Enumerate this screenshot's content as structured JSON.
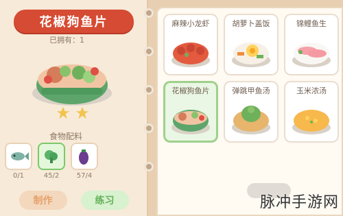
{
  "selected_dish": {
    "title": "花椒狗鱼片",
    "owned_label": "已拥有：1",
    "stars": 2
  },
  "ingredients_label": "食物配料",
  "ingredients": [
    {
      "name": "fish-ingredient",
      "count": "0/1"
    },
    {
      "name": "vegetable-ingredient",
      "count": "45/2"
    },
    {
      "name": "eggplant-ingredient",
      "count": "57/4"
    }
  ],
  "buttons": {
    "make": "制作",
    "practice": "练习"
  },
  "recipes": [
    {
      "title": "麻辣小龙虾"
    },
    {
      "title": "胡萝卜盖饭"
    },
    {
      "title": "锦鲤鱼生"
    },
    {
      "title": "花椒狗鱼片"
    },
    {
      "title": "弹跳甲鱼汤"
    },
    {
      "title": "玉米浓汤"
    }
  ],
  "watermark": "脉冲手游网",
  "colors": {
    "ribbon": "#d64b33",
    "selected_card": "#eaf7e4",
    "page": "#fffaf2"
  }
}
